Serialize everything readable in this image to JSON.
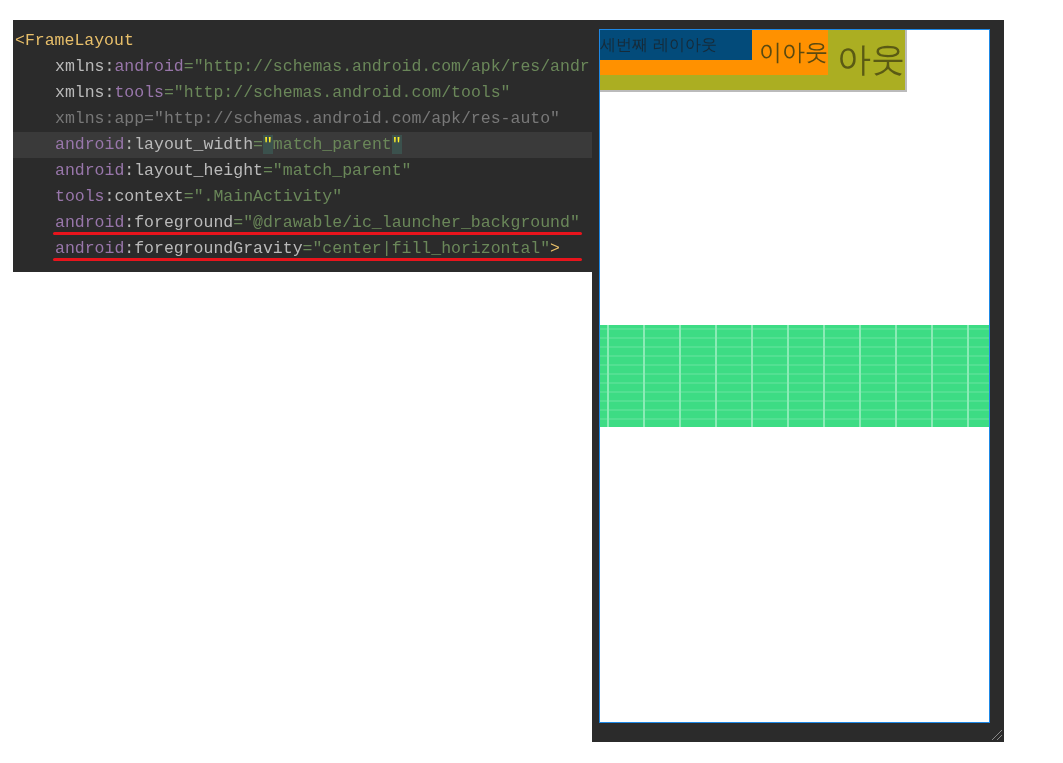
{
  "editor": {
    "lines": [
      {
        "indent": false,
        "current": false,
        "underlined": false,
        "tokens": [
          {
            "kind": "tag",
            "text": "<FrameLayout"
          }
        ]
      },
      {
        "indent": true,
        "current": false,
        "underlined": false,
        "tokens": [
          {
            "kind": "plain",
            "text": "xmlns:"
          },
          {
            "kind": "ns",
            "text": "android"
          },
          {
            "kind": "value",
            "text": "=\"http://schemas.android.com/apk/res/andr"
          }
        ]
      },
      {
        "indent": true,
        "current": false,
        "underlined": false,
        "tokens": [
          {
            "kind": "plain",
            "text": "xmlns:"
          },
          {
            "kind": "ns",
            "text": "tools"
          },
          {
            "kind": "value",
            "text": "=\"http://schemas.android.com/tools\""
          }
        ]
      },
      {
        "indent": true,
        "current": false,
        "underlined": false,
        "tokens": [
          {
            "kind": "dim",
            "text": "xmlns:app=\"http://schemas.android.com/apk/res-auto\""
          }
        ]
      },
      {
        "indent": true,
        "current": true,
        "underlined": false,
        "tokens": [
          {
            "kind": "ns",
            "text": "android"
          },
          {
            "kind": "plain",
            "text": ":layout_width"
          },
          {
            "kind": "value",
            "text": "="
          },
          {
            "kind": "brace",
            "text": "\""
          },
          {
            "kind": "value",
            "text": "match_parent"
          },
          {
            "kind": "brace",
            "text": "\""
          }
        ]
      },
      {
        "indent": true,
        "current": false,
        "underlined": false,
        "tokens": [
          {
            "kind": "ns",
            "text": "android"
          },
          {
            "kind": "plain",
            "text": ":layout_height"
          },
          {
            "kind": "value",
            "text": "=\"match_parent\""
          }
        ]
      },
      {
        "indent": true,
        "current": false,
        "underlined": false,
        "tokens": [
          {
            "kind": "ns",
            "text": "tools"
          },
          {
            "kind": "plain",
            "text": ":context"
          },
          {
            "kind": "value",
            "text": "=\".MainActivity\""
          }
        ]
      },
      {
        "indent": true,
        "current": false,
        "underlined": true,
        "tokens": [
          {
            "kind": "ns",
            "text": "android"
          },
          {
            "kind": "plain",
            "text": ":foreground"
          },
          {
            "kind": "value",
            "text": "=\"@drawable/ic_launcher_background\""
          }
        ]
      },
      {
        "indent": true,
        "current": false,
        "underlined": true,
        "tokens": [
          {
            "kind": "ns",
            "text": "android"
          },
          {
            "kind": "plain",
            "text": ":foregroundGravity"
          },
          {
            "kind": "value",
            "text": "=\"center|fill_horizontal\""
          },
          {
            "kind": "tag",
            "text": ">"
          }
        ]
      }
    ]
  },
  "preview": {
    "layers": [
      {
        "text": "세번째 레이아웃",
        "color": "#034b7a"
      },
      {
        "text": "이아웃",
        "color": "#ff9100"
      },
      {
        "text": "아웃",
        "color": "#abae22"
      }
    ],
    "foreground": {
      "kind": "grid"
    }
  }
}
